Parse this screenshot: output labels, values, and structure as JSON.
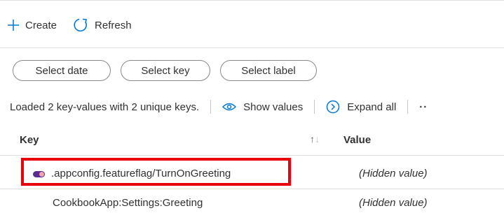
{
  "toolbar": {
    "create_label": "Create",
    "refresh_label": "Refresh"
  },
  "filters": {
    "date_label": "Select date",
    "key_label": "Select key",
    "label_label": "Select label"
  },
  "status": {
    "loaded_text": "Loaded 2 key-values with 2 unique keys.",
    "show_values_label": "Show values",
    "expand_all_label": "Expand all",
    "more_label": "··"
  },
  "table": {
    "key_header": "Key",
    "sort_up": "↑",
    "sort_down": "↓",
    "value_header": "Value",
    "rows": [
      {
        "key": ".appconfig.featureflag/TurnOnGreeting",
        "value": "(Hidden value)",
        "icon": "feature-flag-icon",
        "highlighted": true
      },
      {
        "key": "CookbookApp:Settings:Greeting",
        "value": "(Hidden value)"
      }
    ]
  },
  "colors": {
    "accent": "#0078d4",
    "highlight_border": "#e8000b",
    "feature_flag_icon": "#5c2d91"
  }
}
